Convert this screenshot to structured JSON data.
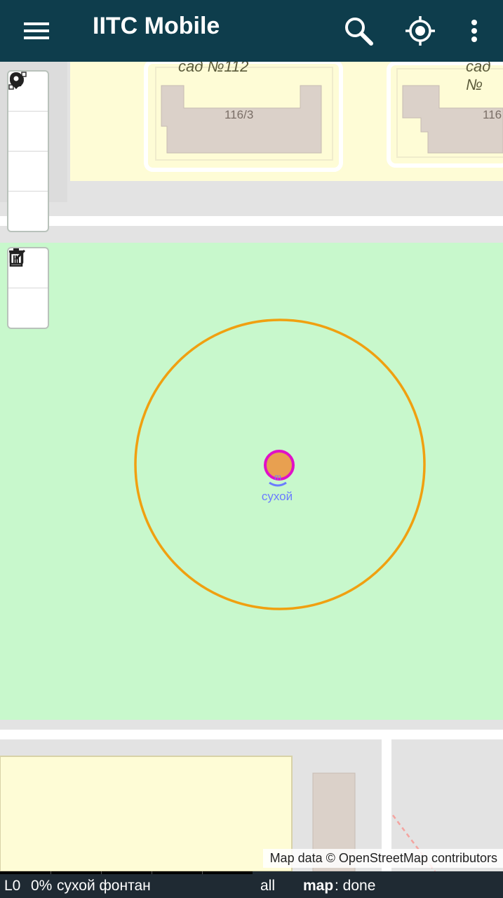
{
  "app_bar": {
    "title": "IITC Mobile",
    "menu_icon": "hamburger-menu-icon",
    "search_icon": "search-icon",
    "locate_icon": "crosshair-locate-icon",
    "overflow_icon": "more-vert-icon",
    "background": "#0e3d4c"
  },
  "map": {
    "labels": {
      "garden_left": "сад №112",
      "garden_right": "сад №",
      "house_left": "116/3",
      "house_right": "116"
    },
    "portal": {
      "name": "сухой",
      "fill_color": "#e8a050",
      "ring_color": "#e010c8"
    },
    "range_circle_color": "#f0a010",
    "park_color": "#c8f8cc",
    "attribution": "Map data © OpenStreetMap contributors"
  },
  "draw_toolbar": {
    "tools": [
      "draw-polyline",
      "draw-polygon",
      "draw-circle",
      "draw-marker"
    ],
    "edit_tools": [
      "edit-layers",
      "delete-layers"
    ]
  },
  "status_bar": {
    "level": "L0",
    "percent": "0%",
    "portal_name": "сухой фонтан",
    "filter": "all",
    "map_label": "map",
    "map_status": ": done"
  }
}
